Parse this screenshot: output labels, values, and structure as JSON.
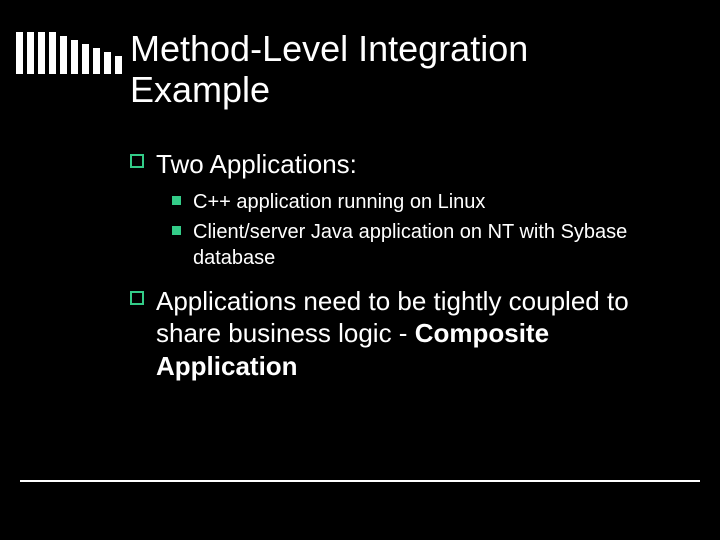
{
  "title": "Method-Level Integration Example",
  "bullets": {
    "b1": {
      "text": "Two Applications:"
    },
    "b1_sub": {
      "s1": "C++ application running on Linux",
      "s2": "Client/server Java application on NT with Sybase database"
    },
    "b2": {
      "part1": "Applications need to be tightly coupled to share business logic - ",
      "bold": "Composite Application"
    }
  },
  "deco": {
    "bar_count": 10
  }
}
